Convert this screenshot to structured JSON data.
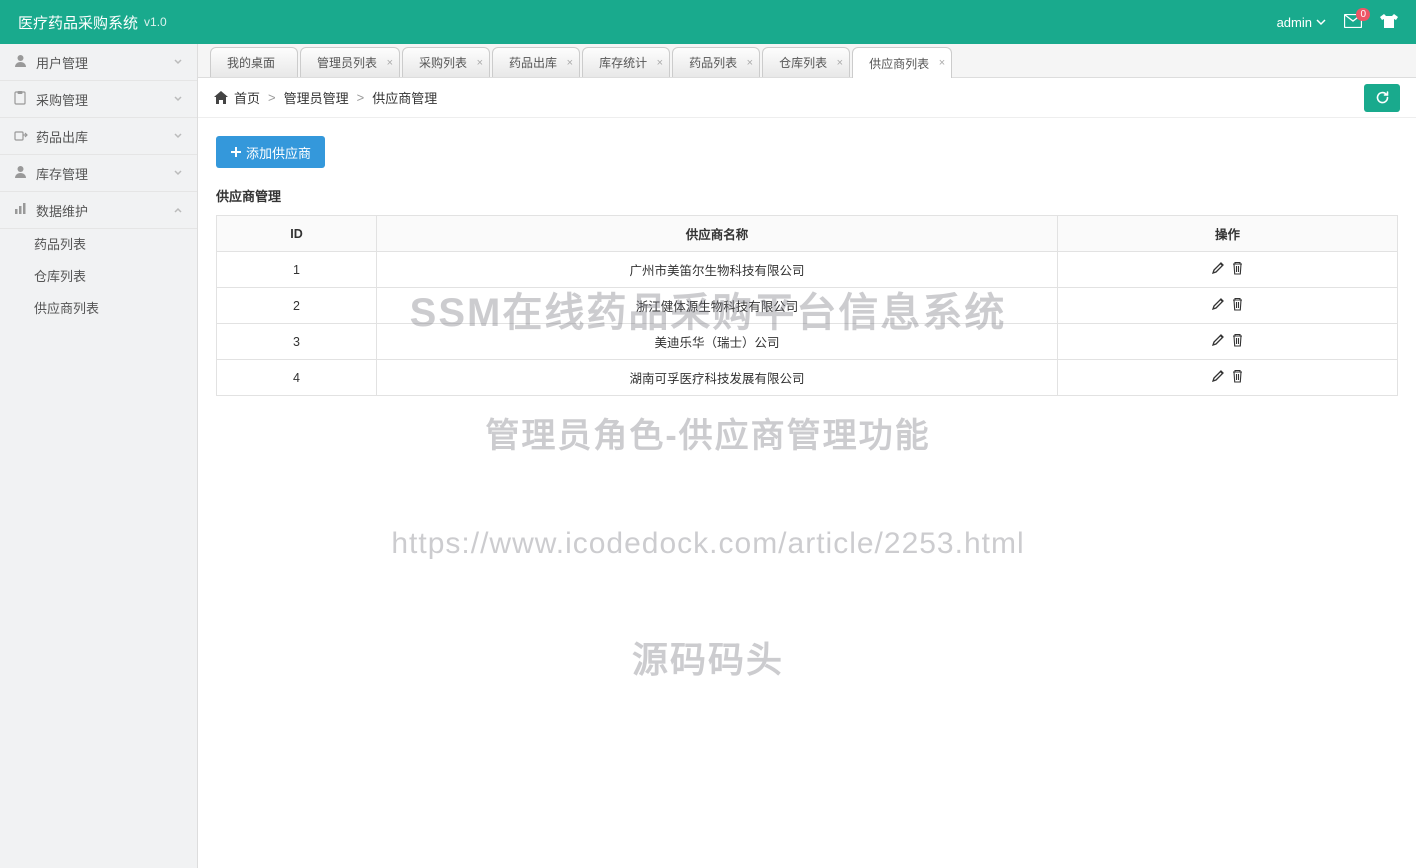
{
  "header": {
    "title": "医疗药品采购系统",
    "version": "v1.0",
    "user": "admin",
    "badge": "0"
  },
  "sidebar": {
    "items": [
      {
        "icon": "user",
        "label": "用户管理",
        "expanded": false
      },
      {
        "icon": "clip",
        "label": "采购管理",
        "expanded": false
      },
      {
        "icon": "out",
        "label": "药品出库",
        "expanded": false
      },
      {
        "icon": "user",
        "label": "库存管理",
        "expanded": false
      },
      {
        "icon": "chart",
        "label": "数据维护",
        "expanded": true
      }
    ],
    "subitems": [
      {
        "label": "药品列表"
      },
      {
        "label": "仓库列表"
      },
      {
        "label": "供应商列表"
      }
    ]
  },
  "tabs": [
    {
      "label": "我的桌面",
      "closable": false,
      "active": false
    },
    {
      "label": "管理员列表",
      "closable": true,
      "active": false
    },
    {
      "label": "采购列表",
      "closable": true,
      "active": false
    },
    {
      "label": "药品出库",
      "closable": true,
      "active": false
    },
    {
      "label": "库存统计",
      "closable": true,
      "active": false
    },
    {
      "label": "药品列表",
      "closable": true,
      "active": false
    },
    {
      "label": "仓库列表",
      "closable": true,
      "active": false
    },
    {
      "label": "供应商列表",
      "closable": true,
      "active": true
    }
  ],
  "breadcrumb": {
    "home": "首页",
    "mid": "管理员管理",
    "leaf": "供应商管理"
  },
  "buttons": {
    "add": "添加供应商"
  },
  "panel": {
    "title": "供应商管理"
  },
  "table": {
    "headers": {
      "id": "ID",
      "name": "供应商名称",
      "ops": "操作"
    },
    "rows": [
      {
        "id": "1",
        "name": "广州市美笛尔生物科技有限公司"
      },
      {
        "id": "2",
        "name": "浙江健体源生物科技有限公司"
      },
      {
        "id": "3",
        "name": "美迪乐华（瑞士）公司"
      },
      {
        "id": "4",
        "name": "湖南可孚医疗科技发展有限公司"
      }
    ]
  },
  "watermark": {
    "l1": "SSM在线药品采购平台信息系统",
    "l2": "管理员角色-供应商管理功能",
    "l3": "https://www.icodedock.com/article/2253.html",
    "l4": "源码码头"
  }
}
